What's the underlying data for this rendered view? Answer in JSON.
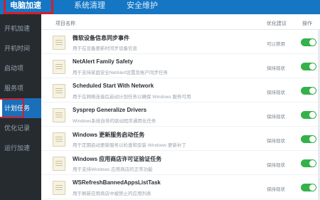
{
  "topnav": {
    "tabs": [
      {
        "label": "电脑加速"
      },
      {
        "label": "系统清理"
      },
      {
        "label": "安全维护"
      }
    ]
  },
  "sidebar": {
    "items": [
      {
        "label": "开机加速"
      },
      {
        "label": "开机时间"
      },
      {
        "label": "启动项"
      },
      {
        "label": "服务项"
      },
      {
        "label": "计划任务"
      },
      {
        "label": "优化记录"
      },
      {
        "label": "运行加速"
      }
    ],
    "active_index": 4
  },
  "table": {
    "headers": {
      "name": "项目名称",
      "suggestion": "优化建议",
      "operation": "操作"
    },
    "rows": [
      {
        "title": "微软设备信息同步事件",
        "desc": "用于在设备更新时同步设备信息",
        "suggestion": "可以禁用",
        "enabled": true
      },
      {
        "title": "NetAlert Family Safety",
        "desc": "用于支持家庭安全NetAlert设置及账户同步任务",
        "suggestion": "保持现状",
        "enabled": true
      },
      {
        "title": "Scheduled Start With Network",
        "desc": "用于在网络连接后启动计划任务以确保 Windows 服务可用",
        "suggestion": "保持现状",
        "enabled": true
      },
      {
        "title": "Sysprep Generalize Drivers",
        "desc": "Windows系统自带的驱动程序通用化任务",
        "suggestion": "保持现状",
        "enabled": true
      },
      {
        "title": "Windows 更新服务启动任务",
        "desc": "用于定期启动更新服务以检查和安装 Windows 更新补丁",
        "suggestion": "保持现状",
        "enabled": true
      },
      {
        "title": "Windows 应用商店许可证验证任务",
        "desc": "用于支持Windows 应用商店的正常功能",
        "suggestion": "保持现状",
        "enabled": true
      },
      {
        "title": "WSRefreshBannedAppsListTask",
        "desc": "用于刷新应用商店中被禁止的应用列表",
        "suggestion": "保持现状",
        "enabled": true
      }
    ]
  },
  "colors": {
    "topbar": "#1576c3",
    "sidebar_bg": "#262b30",
    "sidebar_active": "#1b6fb8",
    "highlight_box": "#d31e2b",
    "toggle_on": "#34b24a"
  }
}
